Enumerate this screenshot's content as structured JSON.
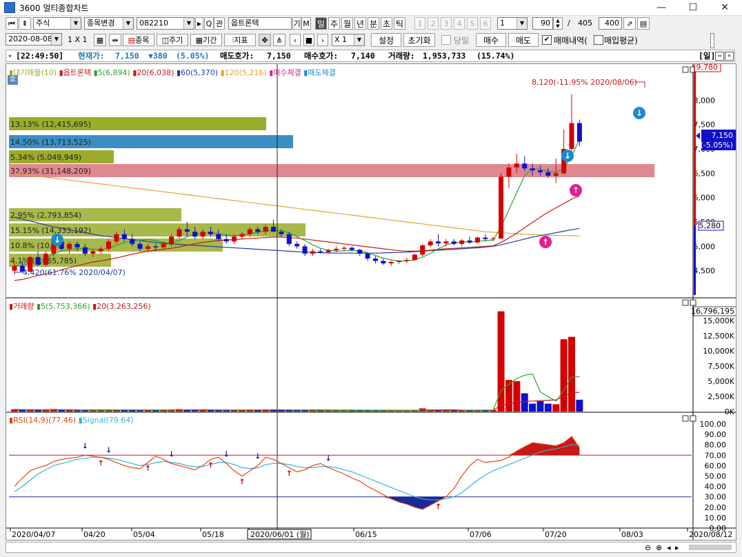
{
  "window": {
    "title": "3600 멀티종합차트",
    "minimize": "—",
    "maximize": "☐",
    "close": "✕"
  },
  "toolbar1": {
    "market_select": "주식",
    "stock_change": "종목변경",
    "code": "082210",
    "search_icon": "Q",
    "relation": "관",
    "stock_name": "옵트론텍",
    "btn_gi": "기",
    "btn_m": "M",
    "periods": [
      "일",
      "주",
      "월",
      "년",
      "분",
      "초",
      "틱"
    ],
    "active_period": "일",
    "num_tabs": [
      "1",
      "2",
      "3",
      "4",
      "5",
      "6"
    ],
    "num_select": "1",
    "count": "90",
    "total_sep": "/",
    "total": "405",
    "display": "400"
  },
  "toolbar2": {
    "date": "2020-08-08",
    "layout": "1 X 1",
    "item_btn": "종목",
    "cycle_btn": "주기",
    "period_btn": "기간",
    "indicator_btn": "지표",
    "multiplier": "X 1",
    "setting": "설정",
    "reset": "초기화",
    "today_label": "당일",
    "buy": "매수",
    "sell": "매도",
    "trade_history": "매매내역(",
    "avg_price": "매입평균)"
  },
  "infobar": {
    "time": "[22:49:50]",
    "price_label": "현재가:",
    "price": "7,150",
    "change": "▼380",
    "change_pct": "(5.05%)",
    "ask_label": "매도호가:",
    "ask": "7,150",
    "bid_label": "매수호가:",
    "bid": "7,140",
    "volume_label": "거래량:",
    "volume": "1,953,733",
    "volume_pct": "(15.74%)",
    "unit": "[일]"
  },
  "colors": {
    "up": "#d40000",
    "down": "#1010c8",
    "ma5": "#2ea02e",
    "ma20": "#c81818",
    "ma60": "#1a3ca8",
    "ma120": "#e8a030",
    "rsi": "#e84010",
    "signal": "#30b4d8"
  },
  "price_legend": {
    "hoga": "호",
    "items": [
      "대기매물(10)",
      "옵트론텍",
      "5(6,894)",
      "20(6,038)",
      "60(5,370)",
      "120(5,216)",
      "매수체결",
      "매도체결"
    ]
  },
  "volume_profile": [
    {
      "label": "13.13% (12,415,695)",
      "color": "#9aac2a"
    },
    {
      "label": "14.50% (13,713,525)",
      "color": "#3a8fc4"
    },
    {
      "label": "5.34% (5,049,949)",
      "color": "#9aac2a"
    },
    {
      "label": "32.93% (31,148,209)",
      "color": "#e08890"
    },
    {
      "label": "2.95% (2,793,854)",
      "color": "#9aac2a"
    },
    {
      "label": "15.15% (14,333,192)",
      "color": "#9aac2a"
    },
    {
      "label": "10.8% (10,...)",
      "color": "#9aac2a"
    },
    {
      "label": "4.1% (3,865,785)",
      "color": "#9aac2a"
    }
  ],
  "price_annotations": {
    "high": "8,120(-11.95% 2020/08/06)",
    "low": "4,420(61.76% 2020/04/07)",
    "top_value": "9,780",
    "cur_price": "7,150",
    "cur_change": "(-5.05%)",
    "bottom_value": "5,280"
  },
  "price_axis": [
    "8,000",
    "7,500",
    "7,000",
    "6,500",
    "6,000",
    "5,500",
    "5,000",
    "4,500"
  ],
  "volume_legend": [
    "거래량",
    "5(5,753,366)",
    "20(3,263,256)"
  ],
  "volume_axis": [
    "16,796,195",
    "15,000K",
    "12,500K",
    "10,000K",
    "7,500K",
    "5,000K",
    "2,500K",
    "0K"
  ],
  "rsi_legend": [
    "RSI(14,9)(77.46)",
    "Signal(79.64)"
  ],
  "rsi_axis": [
    "100.00",
    "90.00",
    "80.00",
    "70.00",
    "60.00",
    "50.00",
    "40.00",
    "30.00",
    "20.00",
    "10.00",
    "0.00"
  ],
  "date_axis": [
    "2020/04/07",
    "04/20",
    "05/04",
    "05/18",
    "2020/06/01 (월)",
    "06/15",
    "07/06",
    "07/20",
    "08/03",
    "2020/08/12"
  ],
  "chart_data": {
    "type": "candlestick",
    "candles": [
      [
        4500,
        4650,
        4420,
        4600
      ],
      [
        4600,
        4700,
        4450,
        4480
      ],
      [
        4480,
        4800,
        4470,
        4780
      ],
      [
        4780,
        4900,
        4600,
        4620
      ],
      [
        4620,
        4900,
        4580,
        4850
      ],
      [
        4850,
        5200,
        4800,
        5100
      ],
      [
        5100,
        5150,
        4900,
        4950
      ],
      [
        4950,
        5100,
        4850,
        5050
      ],
      [
        5050,
        5100,
        4900,
        4980
      ],
      [
        4980,
        5050,
        4800,
        4850
      ],
      [
        4850,
        4950,
        4780,
        4900
      ],
      [
        4900,
        5000,
        4850,
        4950
      ],
      [
        4950,
        5150,
        4900,
        5100
      ],
      [
        5100,
        5300,
        5050,
        5250
      ],
      [
        5250,
        5350,
        5100,
        5150
      ],
      [
        5150,
        5250,
        5000,
        5050
      ],
      [
        5050,
        5100,
        4900,
        4950
      ],
      [
        4950,
        5050,
        4880,
        5000
      ],
      [
        5000,
        5050,
        4900,
        4980
      ],
      [
        4980,
        5100,
        4950,
        5050
      ],
      [
        5050,
        5250,
        5000,
        5200
      ],
      [
        5200,
        5400,
        5150,
        5350
      ],
      [
        5350,
        5500,
        5200,
        5300
      ],
      [
        5300,
        5400,
        5150,
        5200
      ],
      [
        5200,
        5350,
        5150,
        5300
      ],
      [
        5300,
        5400,
        5200,
        5250
      ],
      [
        5250,
        5350,
        5100,
        5150
      ],
      [
        5150,
        5250,
        5050,
        5100
      ],
      [
        5100,
        5250,
        5050,
        5200
      ],
      [
        5200,
        5300,
        5150,
        5250
      ],
      [
        5250,
        5400,
        5200,
        5350
      ],
      [
        5350,
        5400,
        5250,
        5300
      ],
      [
        5300,
        5450,
        5250,
        5400
      ],
      [
        5400,
        5550,
        5350,
        5300
      ],
      [
        5300,
        5350,
        5200,
        5250
      ],
      [
        5250,
        5300,
        5000,
        5050
      ],
      [
        5050,
        5100,
        4950,
        5000
      ],
      [
        5000,
        5050,
        4800,
        4850
      ],
      [
        4850,
        4950,
        4800,
        4900
      ],
      [
        4900,
        4950,
        4850,
        4880
      ],
      [
        4880,
        4950,
        4850,
        4920
      ],
      [
        4920,
        5000,
        4880,
        4950
      ],
      [
        4950,
        5000,
        4900,
        4970
      ],
      [
        4970,
        5000,
        4900,
        4930
      ],
      [
        4930,
        4950,
        4800,
        4850
      ],
      [
        4850,
        4870,
        4700,
        4750
      ],
      [
        4750,
        4800,
        4650,
        4700
      ],
      [
        4700,
        4750,
        4620,
        4650
      ],
      [
        4650,
        4700,
        4600,
        4680
      ],
      [
        4680,
        4720,
        4640,
        4700
      ],
      [
        4700,
        4760,
        4660,
        4720
      ],
      [
        4720,
        4850,
        4700,
        4830
      ],
      [
        4830,
        5050,
        4800,
        5020
      ],
      [
        5020,
        5150,
        4980,
        5100
      ],
      [
        5100,
        5250,
        5000,
        5060
      ],
      [
        5060,
        5150,
        5000,
        5100
      ],
      [
        5100,
        5150,
        5020,
        5050
      ],
      [
        5050,
        5150,
        5000,
        5120
      ],
      [
        5120,
        5200,
        5050,
        5080
      ],
      [
        5080,
        5200,
        5060,
        5180
      ],
      [
        5180,
        5250,
        5100,
        5150
      ],
      [
        5150,
        5200,
        5100,
        5160
      ],
      [
        5160,
        6500,
        5150,
        6430
      ],
      [
        6430,
        6700,
        6200,
        6620
      ],
      [
        6620,
        6900,
        6500,
        6700
      ],
      [
        6700,
        6850,
        6550,
        6600
      ],
      [
        6600,
        6700,
        6450,
        6560
      ],
      [
        6560,
        6650,
        6450,
        6520
      ],
      [
        6520,
        6600,
        6400,
        6450
      ],
      [
        6450,
        6800,
        6300,
        6500
      ],
      [
        6500,
        7400,
        6480,
        7000
      ],
      [
        7000,
        8120,
        6900,
        7530
      ],
      [
        7530,
        7600,
        7050,
        7150
      ]
    ],
    "volumes": [
      350,
      300,
      280,
      260,
      300,
      420,
      250,
      230,
      200,
      190,
      210,
      230,
      280,
      330,
      260,
      230,
      200,
      210,
      220,
      260,
      330,
      400,
      300,
      260,
      280,
      260,
      240,
      220,
      250,
      270,
      300,
      260,
      320,
      360,
      250,
      230,
      210,
      200,
      180,
      170,
      190,
      200,
      180,
      170,
      160,
      150,
      140,
      130,
      150,
      160,
      170,
      260,
      520,
      330,
      250,
      230,
      220,
      240,
      210,
      260,
      250,
      230,
      16500,
      5200,
      5000,
      3000,
      1300,
      1700,
      1300,
      1200,
      11900,
      12300,
      1950
    ],
    "ma5": [
      4600,
      4620,
      4650,
      4700,
      4750,
      4850,
      4900,
      4930,
      4950,
      4960,
      4940,
      4930,
      4960,
      5020,
      5080,
      5110,
      5130,
      5140,
      5120,
      5080,
      5070,
      5120,
      5200,
      5250,
      5270,
      5280,
      5260,
      5230,
      5220,
      5230,
      5260,
      5290,
      5320,
      5330,
      5320,
      5280,
      5200,
      5120,
      5030,
      4960,
      4920,
      4900,
      4910,
      4920,
      4900,
      4870,
      4810,
      4760,
      4720,
      4700,
      4700,
      4720,
      4780,
      4850,
      4950,
      5030,
      5070,
      5090,
      5090,
      5100,
      5120,
      5130,
      5400,
      5750,
      6100,
      6450,
      6600,
      6580,
      6540,
      6520,
      6600,
      6850,
      7200
    ],
    "ma20": [
      4300,
      4320,
      4360,
      4400,
      4430,
      4470,
      4520,
      4560,
      4600,
      4640,
      4680,
      4700,
      4730,
      4760,
      4800,
      4840,
      4870,
      4900,
      4920,
      4940,
      4960,
      4990,
      5020,
      5050,
      5080,
      5100,
      5120,
      5130,
      5140,
      5150,
      5160,
      5170,
      5180,
      5190,
      5190,
      5180,
      5170,
      5150,
      5130,
      5110,
      5090,
      5070,
      5050,
      5030,
      5010,
      4990,
      4970,
      4950,
      4930,
      4910,
      4900,
      4900,
      4910,
      4920,
      4940,
      4950,
      4960,
      4970,
      4980,
      4990,
      5000,
      5010,
      5080,
      5170,
      5270,
      5380,
      5490,
      5600,
      5700,
      5790,
      5880,
      5970,
      6038
    ],
    "ma60": [
      5600,
      5560,
      5520,
      5480,
      5440,
      5400,
      5370,
      5340,
      5310,
      5280,
      5250,
      5220,
      5200,
      5180,
      5160,
      5140,
      5120,
      5100,
      5080,
      5060,
      5050,
      5040,
      5030,
      5020,
      5010,
      5000,
      4990,
      4980,
      4970,
      4960,
      4950,
      4940,
      4930,
      4920,
      4910,
      4900,
      4890,
      4880,
      4875,
      4870,
      4865,
      4860,
      4860,
      4860,
      4860,
      4860,
      4860,
      4865,
      4870,
      4875,
      4880,
      4890,
      4900,
      4910,
      4920,
      4930,
      4940,
      4950,
      4960,
      4970,
      4985,
      5000,
      5030,
      5070,
      5110,
      5150,
      5190,
      5220,
      5250,
      5280,
      5310,
      5340,
      5370
    ],
    "ma120": [
      6500,
      6480,
      6460,
      6440,
      6420,
      6400,
      6380,
      6360,
      6340,
      6320,
      6300,
      6280,
      6260,
      6240,
      6220,
      6200,
      6180,
      6160,
      6140,
      6120,
      6100,
      6080,
      6060,
      6040,
      6020,
      6000,
      5980,
      5960,
      5940,
      5920,
      5900,
      5880,
      5860,
      5840,
      5820,
      5800,
      5780,
      5760,
      5740,
      5720,
      5700,
      5680,
      5660,
      5640,
      5620,
      5600,
      5580,
      5560,
      5540,
      5520,
      5500,
      5480,
      5460,
      5440,
      5420,
      5400,
      5380,
      5360,
      5340,
      5320,
      5300,
      5290,
      5280,
      5270,
      5260,
      5250,
      5240,
      5235,
      5230,
      5225,
      5220,
      5218,
      5216
    ],
    "rsi": [
      40,
      48,
      55,
      58,
      60,
      64,
      66,
      67,
      68,
      70,
      69,
      68,
      66,
      63,
      60,
      58,
      57,
      63,
      69,
      66,
      62,
      60,
      58,
      56,
      60,
      66,
      68,
      62,
      55,
      50,
      55,
      60,
      68,
      66,
      62,
      58,
      54,
      56,
      60,
      62,
      58,
      55,
      52,
      48,
      45,
      40,
      36,
      32,
      28,
      25,
      23,
      20,
      18,
      22,
      26,
      30,
      38,
      50,
      60,
      66,
      63,
      64,
      65,
      68,
      74,
      78,
      82,
      81,
      80,
      79,
      82,
      88,
      77
    ],
    "signal": [
      35,
      40,
      46,
      52,
      56,
      60,
      62,
      64,
      66,
      67,
      68,
      68,
      67,
      66,
      64,
      62,
      60,
      61,
      63,
      64,
      63,
      62,
      60,
      59,
      59,
      61,
      63,
      63,
      61,
      58,
      57,
      58,
      61,
      62,
      62,
      61,
      59,
      58,
      58,
      59,
      59,
      58,
      56,
      54,
      51,
      48,
      45,
      42,
      39,
      36,
      33,
      30,
      28,
      27,
      27,
      28,
      30,
      34,
      40,
      46,
      51,
      55,
      58,
      61,
      64,
      67,
      70,
      73,
      75,
      76,
      78,
      80,
      79.64
    ],
    "rsi_threshold_high": 70,
    "rsi_threshold_low": 30
  }
}
